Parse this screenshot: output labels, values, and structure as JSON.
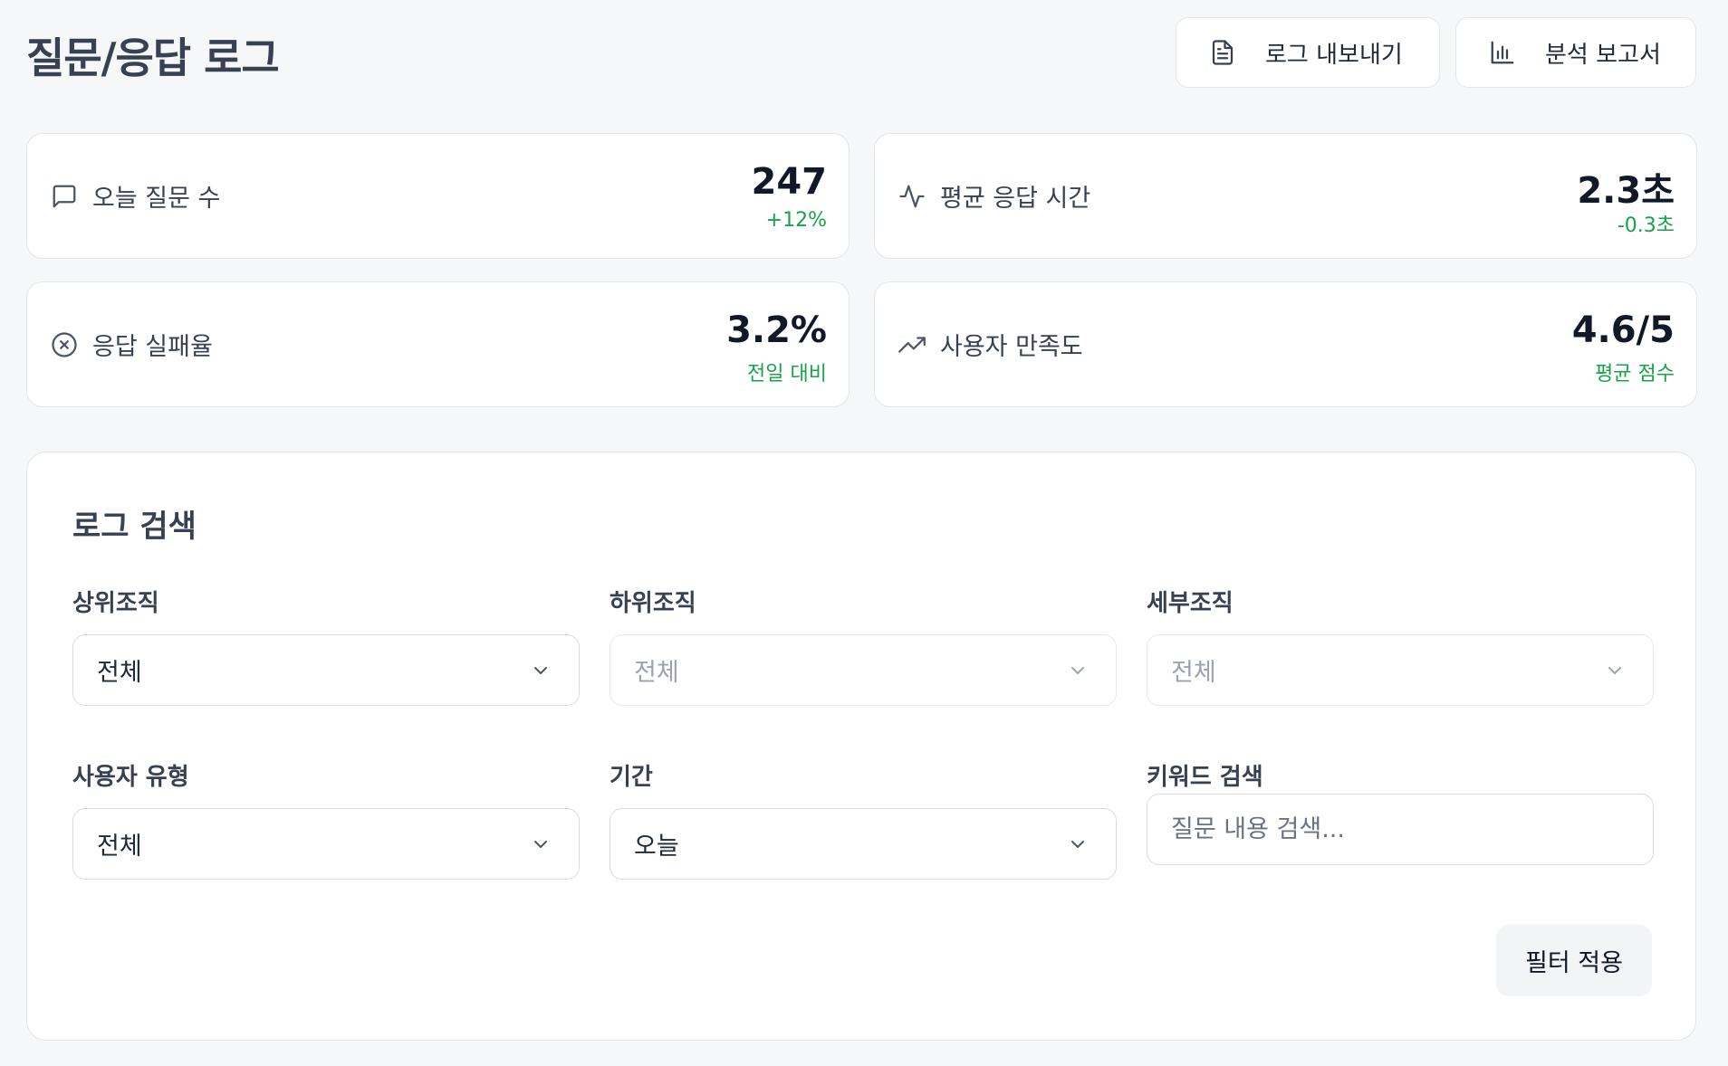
{
  "header": {
    "title": "질문/응답 로그",
    "export_label": "로그 내보내기",
    "report_label": "분석 보고서"
  },
  "stats": [
    {
      "icon": "message-square-icon",
      "label": "오늘 질문 수",
      "value": "247",
      "sub": "+12%",
      "sub_color": "#16a34a"
    },
    {
      "icon": "activity-icon",
      "label": "평균 응답 시간",
      "value": "2.3초",
      "sub": "-0.3초",
      "sub_color": "#16a34a"
    },
    {
      "icon": "x-circle-icon",
      "label": "응답 실패율",
      "value": "3.2%",
      "sub": "전일 대비",
      "sub_color": "#16a34a"
    },
    {
      "icon": "trending-up-icon",
      "label": "사용자 만족도",
      "value": "4.6/5",
      "sub": "평균 점수",
      "sub_color": "#16a34a"
    }
  ],
  "search": {
    "title": "로그 검색",
    "fields": {
      "upper_org": {
        "label": "상위조직",
        "value": "전체",
        "disabled": false
      },
      "lower_org": {
        "label": "하위조직",
        "value": "전체",
        "disabled": true
      },
      "detail_org": {
        "label": "세부조직",
        "value": "전체",
        "disabled": true
      },
      "user_type": {
        "label": "사용자 유형",
        "value": "전체",
        "disabled": false
      },
      "period": {
        "label": "기간",
        "value": "오늘",
        "disabled": false
      },
      "keyword": {
        "label": "키워드 검색",
        "placeholder": "질문 내용 검색...",
        "value": ""
      }
    },
    "apply_label": "필터 적용"
  },
  "colors": {
    "background": "#f6f7f9",
    "positive": "#16a34a",
    "border": "#e2e5ea"
  }
}
